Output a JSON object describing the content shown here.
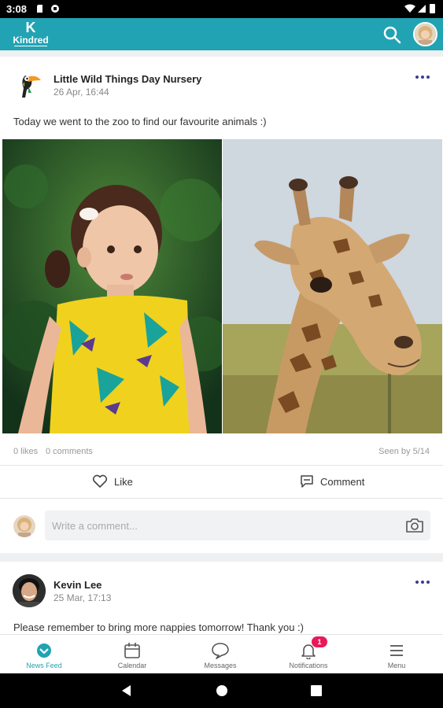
{
  "status_bar": {
    "time": "3:08"
  },
  "app_bar": {
    "logo_text": "Kindred",
    "logo_letter": "K"
  },
  "posts": [
    {
      "author": "Little Wild Things Day Nursery",
      "date": "26 Apr, 16:44",
      "text": "Today we went to the zoo to find our favourite animals :)",
      "likes": "0 likes",
      "comments": "0 comments",
      "seen": "Seen by 5/14",
      "like_label": "Like",
      "comment_label": "Comment",
      "comment_placeholder": "Write a comment..."
    },
    {
      "author": "Kevin Lee",
      "date": "25 Mar, 17:13",
      "text": "Please remember to bring more nappies tomorrow! Thank you :)"
    }
  ],
  "tabs": [
    {
      "label": "News Feed",
      "icon": "news-feed-icon"
    },
    {
      "label": "Calendar",
      "icon": "calendar-icon"
    },
    {
      "label": "Messages",
      "icon": "messages-icon"
    },
    {
      "label": "Notifications",
      "icon": "bell-icon",
      "badge": "1"
    },
    {
      "label": "Menu",
      "icon": "menu-icon"
    }
  ],
  "colors": {
    "accent": "#21a3b3",
    "badge": "#e8195a"
  }
}
